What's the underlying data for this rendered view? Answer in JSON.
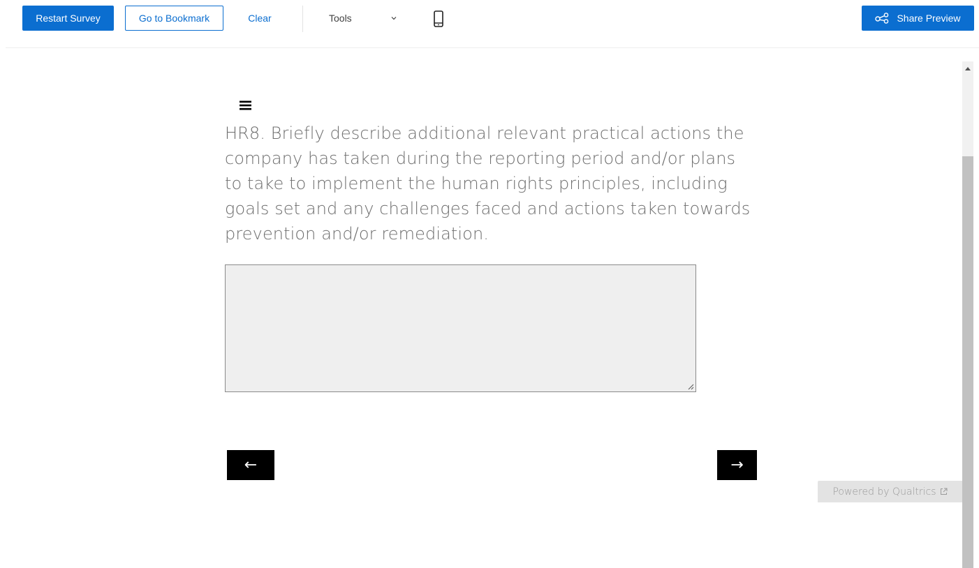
{
  "toolbar": {
    "restart_label": "Restart Survey",
    "bookmark_label": "Go to Bookmark",
    "clear_label": "Clear",
    "tools_label": "Tools",
    "tools_icon": "chevron-down-icon",
    "mobile_icon": "mobile-phone-icon",
    "share_label": "Share Preview",
    "share_icon": "share-icon"
  },
  "survey": {
    "menu_icon": "hamburger-menu-icon",
    "question_text": "HR8. Briefly describe additional relevant practical actions the company has taken during the reporting period and/or plans to take to implement the human rights principles, including goals set and any challenges faced and actions taken towards prevention and/or remediation.",
    "answer_value": "",
    "back_label": "←",
    "next_label": "→"
  },
  "footer": {
    "powered_by": "Powered by Qualtrics",
    "powered_icon": "external-link-icon"
  },
  "colors": {
    "accent": "#0b6ed0",
    "question_text": "#6e6e6e",
    "nav_button": "#000000",
    "answer_bg": "#efefef"
  }
}
